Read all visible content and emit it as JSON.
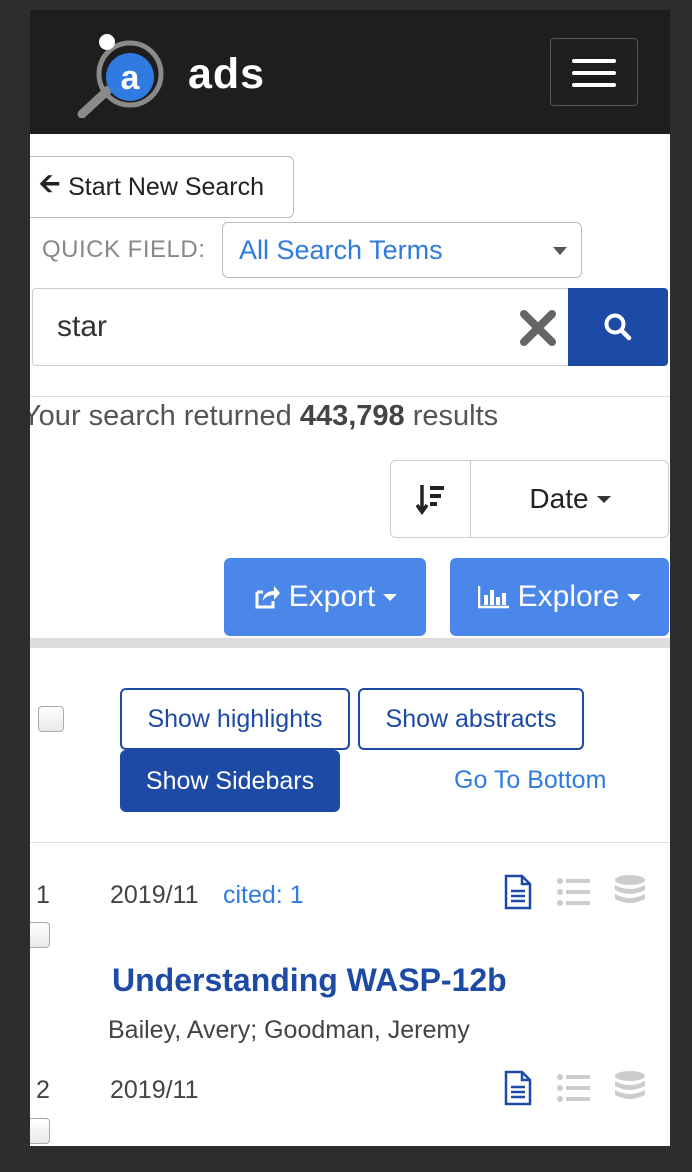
{
  "header": {
    "brand": "ads",
    "logo_letter": "a"
  },
  "search": {
    "start_new_label": "Start New Search",
    "quick_field_label": "QUICK FIELD:",
    "quick_field_value": "All Search Terms",
    "query": "star"
  },
  "results": {
    "prefix": "Your search returned",
    "count": "443,798",
    "suffix": "results"
  },
  "sort": {
    "label": "Date"
  },
  "actions": {
    "export_label": "Export",
    "explore_label": "Explore"
  },
  "toolbar": {
    "show_highlights": "Show highlights",
    "show_abstracts": "Show abstracts",
    "show_sidebars": "Show Sidebars",
    "go_to_bottom": "Go To Bottom"
  },
  "items": [
    {
      "index": "1",
      "date": "2019/11",
      "cited": "cited: 1",
      "title": "Understanding WASP-12b",
      "authors": "Bailey, Avery;  Goodman, Jeremy"
    },
    {
      "index": "2",
      "date": "2019/11"
    }
  ],
  "colors": {
    "accent": "#1d4aa5",
    "link": "#2f7be0",
    "button": "#4a87e8",
    "navbar": "#1e1e1e"
  }
}
